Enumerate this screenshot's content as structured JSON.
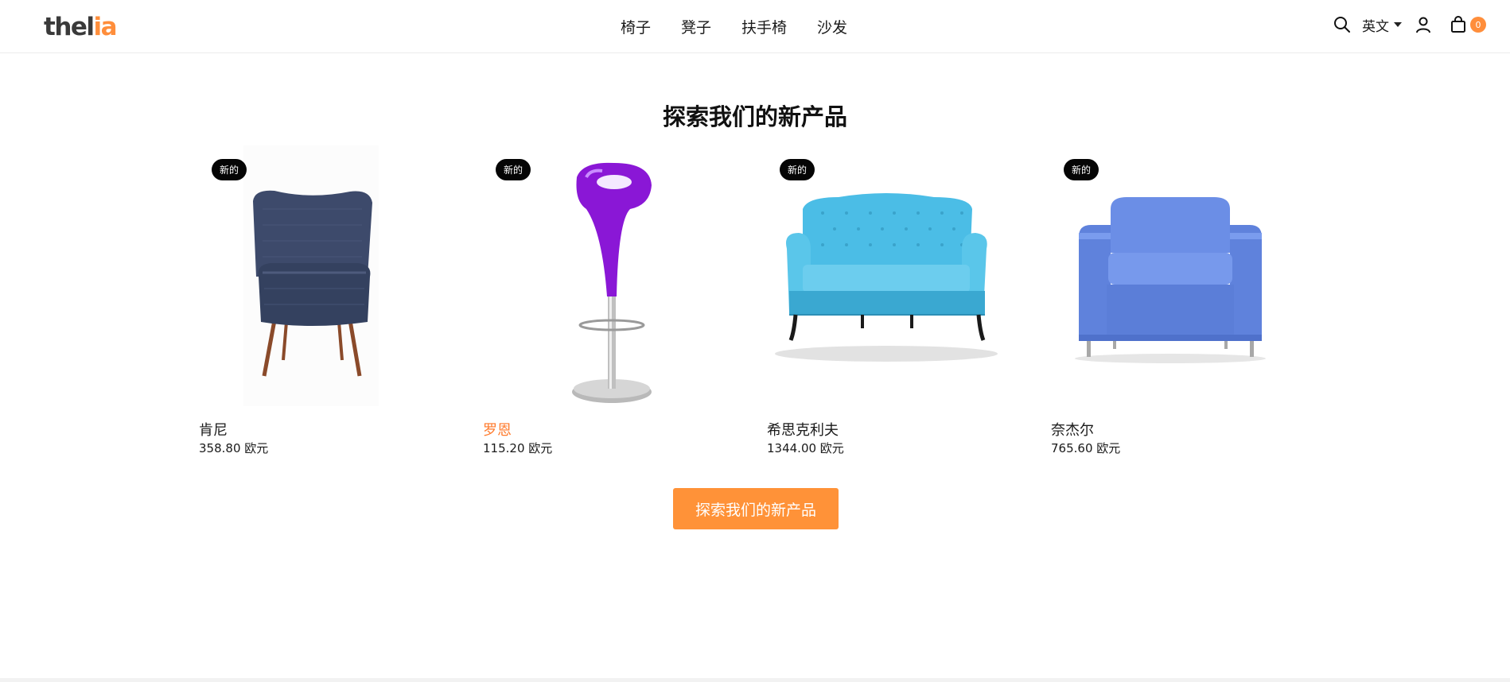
{
  "brand": {
    "logo_main": "thel",
    "logo_accent": "ia"
  },
  "nav": {
    "items": [
      {
        "label": "椅子"
      },
      {
        "label": "凳子"
      },
      {
        "label": "扶手椅"
      },
      {
        "label": "沙发"
      }
    ]
  },
  "header_tools": {
    "search_icon": "search-icon",
    "language": {
      "label": "英文"
    },
    "user_icon": "user-icon",
    "cart": {
      "icon": "shopping-bag-icon",
      "count": "0"
    }
  },
  "section": {
    "title": "探索我们的新产品"
  },
  "products": [
    {
      "name": "肯尼",
      "price": "358.80 欧元",
      "badge": "新的"
    },
    {
      "name": "罗恩",
      "price": "115.20 欧元",
      "badge": "新的"
    },
    {
      "name": "希思克利夫",
      "price": "1344.00 欧元",
      "badge": "新的"
    },
    {
      "name": "奈杰尔",
      "price": "765.60 欧元",
      "badge": "新的"
    }
  ],
  "cta": {
    "label": "探索我们的新产品"
  },
  "colors": {
    "accent": "#ff8e3b",
    "badge_bg": "#050505",
    "hover_text": "#ff7a2b"
  }
}
